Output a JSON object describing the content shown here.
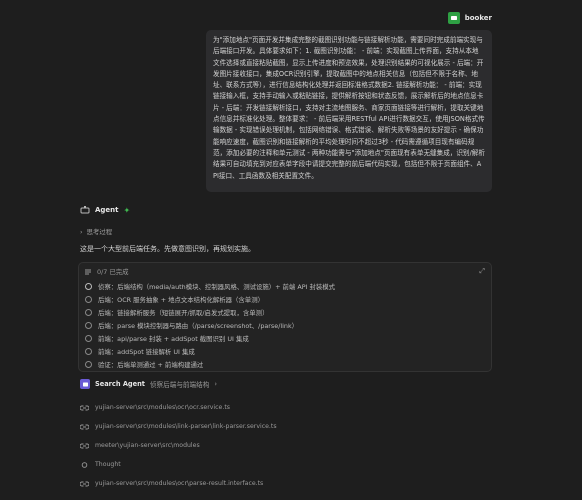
{
  "user": {
    "name": "booker"
  },
  "message": {
    "text": "为\"添加地点\"页面开发并集成完整的截图识别功能与链接解析功能，需要同时完成前端实现与后端接口开发。具体要求如下：1. 截图识别功能： - 前端：实现截图上传界面，支持从本地文件选择或直接粘贴截图，显示上传进度和预览效果，处理识别结果的可视化展示 - 后端：开发图片接收接口，集成OCR识别引擎，提取截图中的地点相关信息（包括但不限于名称、地址、联系方式等），进行信息结构化处理并返回标准格式数据2. 链接解析功能： - 前端：实现链接输入框，支持手动输入或粘贴链接，提供解析按钮和状态反馈，展示解析后的地点信息卡片 - 后端：开发链接解析接口，支持对主流地图服务、商家页面链接等进行解析，提取关键地点信息并标准化处理。整体要求： - 前后端采用RESTful API进行数据交互，使用JSON格式传输数据 - 实现错误处理机制，包括网络错误、格式错误、解析失败等场景的友好提示 - 确保功能响应速度，截图识别和链接解析的平均处理时间不超过3秒 - 代码需遵循项目现有编码规范，添加必要的注释和单元测试 - 两种功能需与\"添加地点\"页面现有表单无缝集成，识别/解析结果可自动填充到对应表单字段中请提交完整的前后端代码实现，包括但不限于页面组件、API接口、工具函数及相关配置文件。"
  },
  "agent": {
    "label": "Agent"
  },
  "thinking": {
    "label": "思考过程"
  },
  "intro": "这是一个大型前后端任务。先做意图识别，再规划实施。",
  "todo": {
    "count": "0/7 已完成",
    "items": [
      "侦察：后端结构（media/auth模块、控制器风格、测试设施）+ 前端 API 封装模式",
      "后端：OCR 服务抽象 + 地点文本结构化解析器（含单测）",
      "后端：链接解析服务（短链展开/抓取/启发式提取，含单测）",
      "后端：parse 模块控制器与路由（/parse/screenshot、/parse/link）",
      "前端：api/parse 封装 + addSpot 截图识别 UI 集成",
      "前端：addSpot 链接解析 UI 集成",
      "验证：后端单测通过 + 前端构建通过"
    ]
  },
  "search_agent": {
    "title": "Search Agent",
    "desc": "侦察后端与前端结构"
  },
  "files": [
    "yujian-server\\src\\modules\\ocr\\ocr.service.ts",
    "yujian-server\\src\\modules\\link-parser\\link-parser.service.ts",
    "meeter\\yujian-server\\src\\modules",
    "Thought",
    "yujian-server\\src\\modules\\ocr\\parse-result.interface.ts"
  ]
}
